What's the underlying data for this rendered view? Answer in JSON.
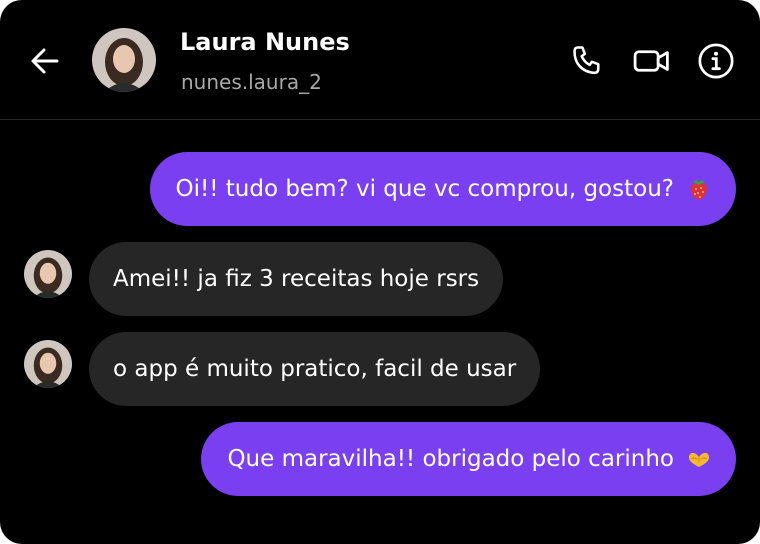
{
  "header": {
    "name": "Laura Nunes",
    "username": "nunes.laura_2",
    "icons": {
      "back": "arrow-left-icon",
      "call": "phone-icon",
      "video": "video-camera-icon",
      "info": "info-icon"
    }
  },
  "messages": [
    {
      "direction": "sent",
      "text": "Oi!! tudo bem? vi que vc comprou, gostou?",
      "emoji": "strawberry-emoji"
    },
    {
      "direction": "received",
      "text": "Amei!! ja fiz 3 receitas hoje rsrs"
    },
    {
      "direction": "received",
      "text": "o app é muito pratico, facil de usar"
    },
    {
      "direction": "sent",
      "text": "Que maravilha!! obrigado pelo carinho",
      "emoji": "heart-hands-emoji"
    }
  ],
  "colors": {
    "background": "#000000",
    "sent_bubble": "#7a3ff0",
    "received_bubble": "#262626",
    "username": "#a8a8a8"
  }
}
